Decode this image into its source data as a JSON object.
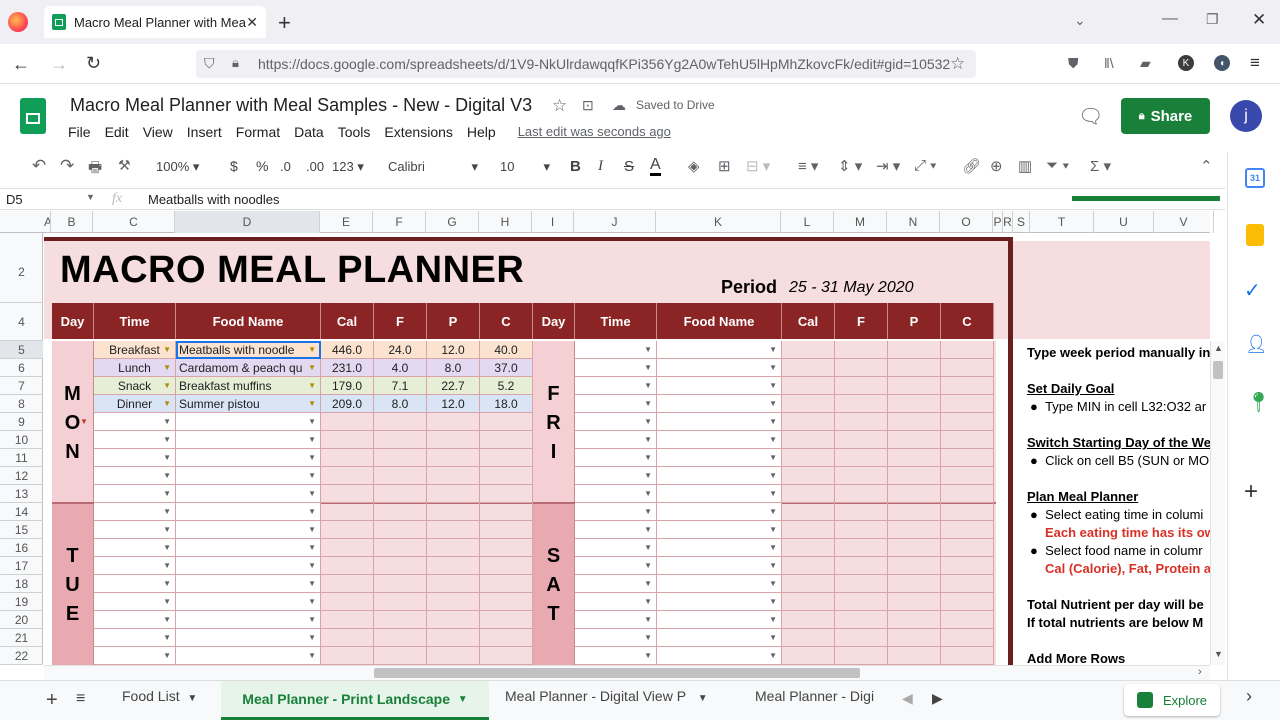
{
  "browser": {
    "tab_title": "Macro Meal Planner with Meal",
    "url": "https://docs.google.com/spreadsheets/d/1V9-NkUlrdawqqfKPi356Yg2A0wTehU5lHpMhZkovcFk/edit#gid=10532",
    "profile_initial": "K"
  },
  "doc": {
    "title": "Macro Meal Planner with Meal Samples -  New - Digital V3",
    "saved_status": "Saved to Drive",
    "last_edit": "Last edit was seconds ago",
    "share_label": "Share",
    "avatar_initial": "j"
  },
  "menu": [
    "File",
    "Edit",
    "View",
    "Insert",
    "Format",
    "Data",
    "Tools",
    "Extensions",
    "Help"
  ],
  "toolbar": {
    "zoom": "100%",
    "currency": "$",
    "percent": "%",
    "dec_less": ".0",
    "dec_more": ".00",
    "format": "123",
    "font": "Calibri",
    "font_size": "10",
    "bold": "B",
    "italic": "I",
    "strike": "S",
    "text_color": "A"
  },
  "formula_bar": {
    "cell_ref": "D5",
    "fx": "fx",
    "value": "Meatballs with noodles"
  },
  "columns": [
    "A",
    "B",
    "C",
    "D",
    "E",
    "F",
    "G",
    "H",
    "I",
    "J",
    "K",
    "L",
    "M",
    "N",
    "O",
    "P",
    "R",
    "S",
    "T",
    "U",
    "V"
  ],
  "rows": [
    "2",
    "4",
    "5",
    "6",
    "7",
    "8",
    "9",
    "10",
    "11",
    "12",
    "13",
    "14",
    "15",
    "16",
    "17",
    "18",
    "19",
    "20",
    "21",
    "22"
  ],
  "sheet": {
    "title": "MACRO MEAL PLANNER",
    "period_label": "Period",
    "period_value": "25 - 31 May 2020",
    "headers_left": [
      "Day",
      "Time",
      "Food Name",
      "Cal",
      "F",
      "P",
      "C"
    ],
    "headers_right": [
      "Day",
      "Time",
      "Food Name",
      "Cal",
      "F",
      "P",
      "C"
    ],
    "mon_letters": [
      "M",
      "O",
      "N"
    ],
    "tue_letters": [
      "T",
      "U",
      "E"
    ],
    "fri_letters": [
      "F",
      "R",
      "I"
    ],
    "sat_letters": [
      "S",
      "A",
      "T"
    ],
    "meals": [
      {
        "time": "Breakfast",
        "food": "Meatballs with noodle",
        "cal": "446.0",
        "f": "24.0",
        "p": "12.0",
        "c": "40.0"
      },
      {
        "time": "Lunch",
        "food": "Cardamom & peach qu",
        "cal": "231.0",
        "f": "4.0",
        "p": "8.0",
        "c": "37.0"
      },
      {
        "time": "Snack",
        "food": "Breakfast muffins",
        "cal": "179.0",
        "f": "7.1",
        "p": "22.7",
        "c": "5.2"
      },
      {
        "time": "Dinner",
        "food": "Summer pistou",
        "cal": "209.0",
        "f": "8.0",
        "p": "12.0",
        "c": "18.0"
      }
    ]
  },
  "instructions": {
    "line1": "Type week period manually in",
    "set_goal": "Set Daily Goal",
    "set_goal_bullet": "Type MIN in cell L32:O32 ar",
    "switch_day": "Switch Starting Day of the We",
    "switch_bullet": "Click on cell B5 (SUN or MO",
    "plan": "Plan Meal Planner",
    "plan_bullet1": "Select eating time in columi",
    "plan_red1": "Each eating time has its ow",
    "plan_bullet2": "Select food name in columr",
    "plan_red2": "Cal (Calorie), Fat, Protein a",
    "total1": "Total Nutrient per day will be",
    "total2": "If total nutrients are below M",
    "add_rows": "Add More Rows"
  },
  "sheet_tabs": [
    "Food List",
    "Meal Planner - Print Landscape",
    "Meal Planner - Digital View P",
    "Meal Planner - Digi"
  ],
  "explore_label": "Explore",
  "colors": {
    "share_green": "#188038",
    "header_maroon": "#8b2424",
    "pink_bg": "#f6dde0",
    "mon_pink": "#f4cfd4",
    "tue_pink": "#e9a9b1"
  }
}
